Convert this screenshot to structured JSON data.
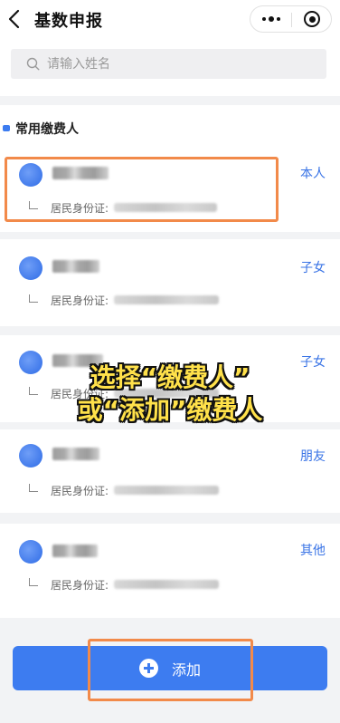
{
  "nav": {
    "title": "基数申报",
    "back_icon": "chevron-left-icon",
    "more_icon": "more-dots-icon",
    "target_icon": "target-icon"
  },
  "search": {
    "placeholder": "请输入姓名",
    "icon": "search-icon"
  },
  "section": {
    "title": "常用缴费人"
  },
  "payers": [
    {
      "relation": "本人",
      "id_label": "居民身份证:"
    },
    {
      "relation": "子女",
      "id_label": "居民身份证:"
    },
    {
      "relation": "子女",
      "id_label": "居民身份证:"
    },
    {
      "relation": "朋友",
      "id_label": "居民身份证:"
    },
    {
      "relation": "其他",
      "id_label": "居民身份证:"
    }
  ],
  "caption": {
    "line1": "选择“缴费人”",
    "line2": "或“添加”缴费人"
  },
  "add_button": {
    "label": "添加",
    "icon": "plus-circle-icon"
  },
  "colors": {
    "accent": "#3d7cf0",
    "relation_text": "#3a74e6",
    "highlight_border": "#f28a4a",
    "caption_text": "#ffe14a"
  }
}
